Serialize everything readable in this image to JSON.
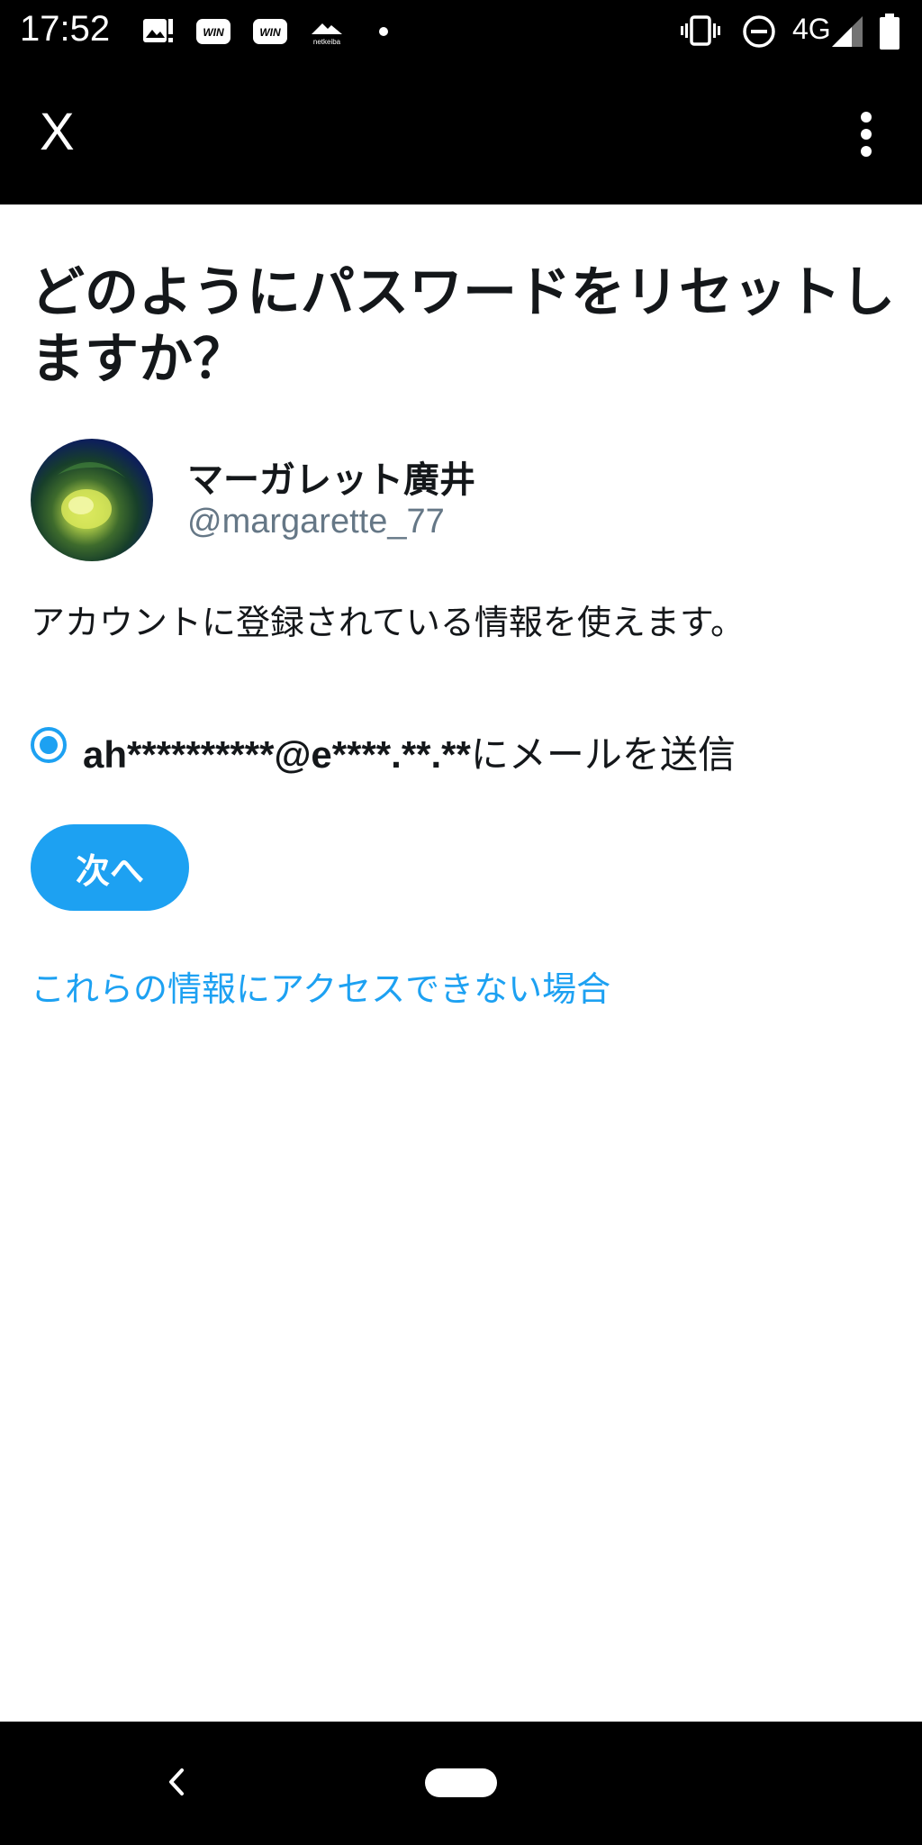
{
  "status_bar": {
    "time": "17:52",
    "network": "4G",
    "notification_icons": [
      "gallery-icon",
      "win-icon",
      "win-icon",
      "netkeiba-icon",
      "dot-icon"
    ],
    "netkeiba_label": "netkeiba",
    "win_label": "WIN"
  },
  "app_bar": {
    "close_label": "X",
    "menu_icon": "more-vertical-icon"
  },
  "page": {
    "title": "どのようにパスワードをリセットしますか？",
    "display_name": "マーガレット廣井",
    "handle": "@margarette_77",
    "description": "アカウントに登録されている情報を使えます。",
    "option_email": "ah**********@e****.**.**",
    "option_suffix": "にメールを送信",
    "next_label": "次へ",
    "help_link": "これらの情報にアクセスできない場合"
  },
  "colors": {
    "accent": "#1da1f2",
    "text": "#14171a",
    "secondary_text": "#657786",
    "bars": "#000000"
  }
}
